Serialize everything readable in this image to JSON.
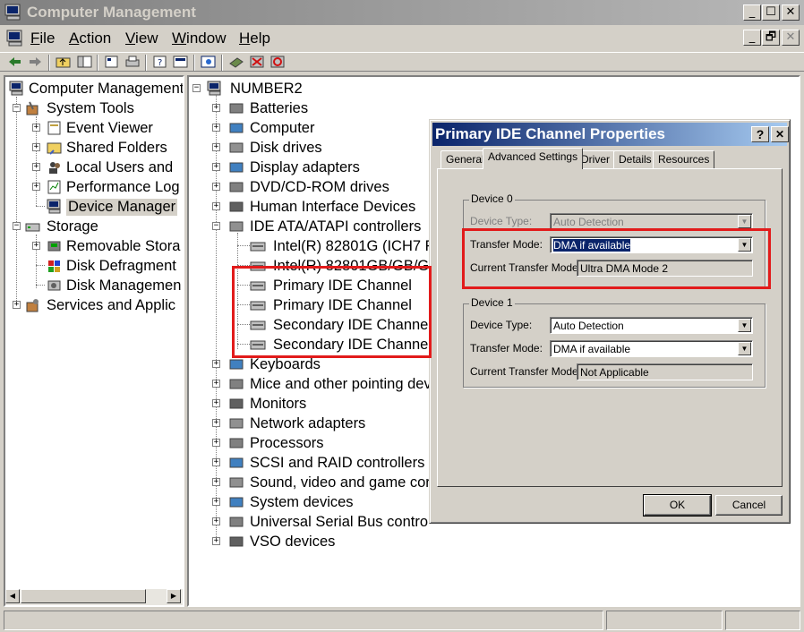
{
  "window": {
    "title": "Computer Management"
  },
  "menu": [
    {
      "first": "F",
      "rest": "ile"
    },
    {
      "first": "A",
      "rest": "ction"
    },
    {
      "first": "V",
      "rest": "iew"
    },
    {
      "first": "W",
      "rest": "indow"
    },
    {
      "first": "H",
      "rest": "elp"
    }
  ],
  "caption": {
    "minimize": "_",
    "maximize": "☐",
    "close": "✕",
    "restore": "🗗"
  },
  "left_tree": {
    "root": "Computer Management",
    "system_tools": "System Tools",
    "event_viewer": "Event Viewer",
    "shared_folders": "Shared Folders",
    "local_users": "Local Users and",
    "performance": "Performance Log",
    "device_manager": "Device Manager",
    "storage": "Storage",
    "removable": "Removable Stora",
    "defrag": "Disk Defragment",
    "disk_mgmt": "Disk Managemen",
    "services": "Services and Applic"
  },
  "right_tree": {
    "root": "NUMBER2",
    "items": [
      "Batteries",
      "Computer",
      "Disk drives",
      "Display adapters",
      "DVD/CD-ROM drives",
      "Human Interface Devices",
      "IDE ATA/ATAPI controllers"
    ],
    "ide_children": [
      "Intel(R) 82801G (ICH7 F",
      "Intel(R) 82801GB/GB/G",
      "Primary IDE Channel",
      "Primary IDE Channel",
      "Secondary IDE Channel",
      "Secondary IDE Channel"
    ],
    "items_after": [
      "Keyboards",
      "Mice and other pointing dev",
      "Monitors",
      "Network adapters",
      "Processors",
      "SCSI and RAID controllers",
      "Sound, video and game cor",
      "System devices",
      "Universal Serial Bus contro",
      "VSO devices"
    ]
  },
  "dialog": {
    "title": "Primary IDE Channel Properties",
    "help_btn": "?",
    "close_btn": "✕",
    "tabs": [
      "General",
      "Advanced Settings",
      "Driver",
      "Details",
      "Resources"
    ],
    "device0": {
      "label": "Device 0",
      "type_label": "Device Type:",
      "type_value": "Auto Detection",
      "mode_label": "Transfer Mode:",
      "mode_value": "DMA if available",
      "current_label": "Current Transfer Mode:",
      "current_value": "Ultra DMA Mode 2"
    },
    "device1": {
      "label": "Device 1",
      "type_label": "Device Type:",
      "type_value": "Auto Detection",
      "mode_label": "Transfer Mode:",
      "mode_value": "DMA if available",
      "current_label": "Current Transfer Mode:",
      "current_value": "Not Applicable"
    },
    "ok": "OK",
    "cancel": "Cancel"
  },
  "icons": {
    "dropdown": "▼",
    "scroll_left": "◀",
    "scroll_right": "▶"
  },
  "colors": {
    "highlight": "#e21b1b",
    "active_title": "#0a246a",
    "inactive_title": "#808080"
  }
}
